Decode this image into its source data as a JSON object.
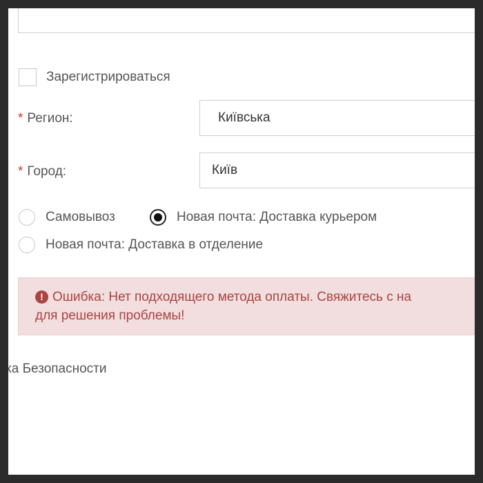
{
  "checkout": {
    "register_label": "Зарегистрироваться",
    "region": {
      "required_mark": "*",
      "label": "Регион:",
      "value": "Київська"
    },
    "city": {
      "required_mark": "*",
      "label": "Город:",
      "value": "Київ"
    },
    "delivery": {
      "options": [
        {
          "label": "Самовывоз",
          "selected": false
        },
        {
          "label": "Новая почта: Доставка курьером",
          "selected": true
        },
        {
          "label": "Новая почта: Доставка в отделение",
          "selected": false
        }
      ]
    },
    "error": {
      "icon": "exclamation-circle-icon",
      "line1": "Ошибка: Нет подходящего метода оплаты. Свяжитесь с на",
      "line2": "для решения проблемы!"
    },
    "footer_link": "ка Безопасности"
  },
  "colors": {
    "error_text": "#a94442",
    "error_bg": "#f2dede",
    "required": "#c0392b"
  }
}
